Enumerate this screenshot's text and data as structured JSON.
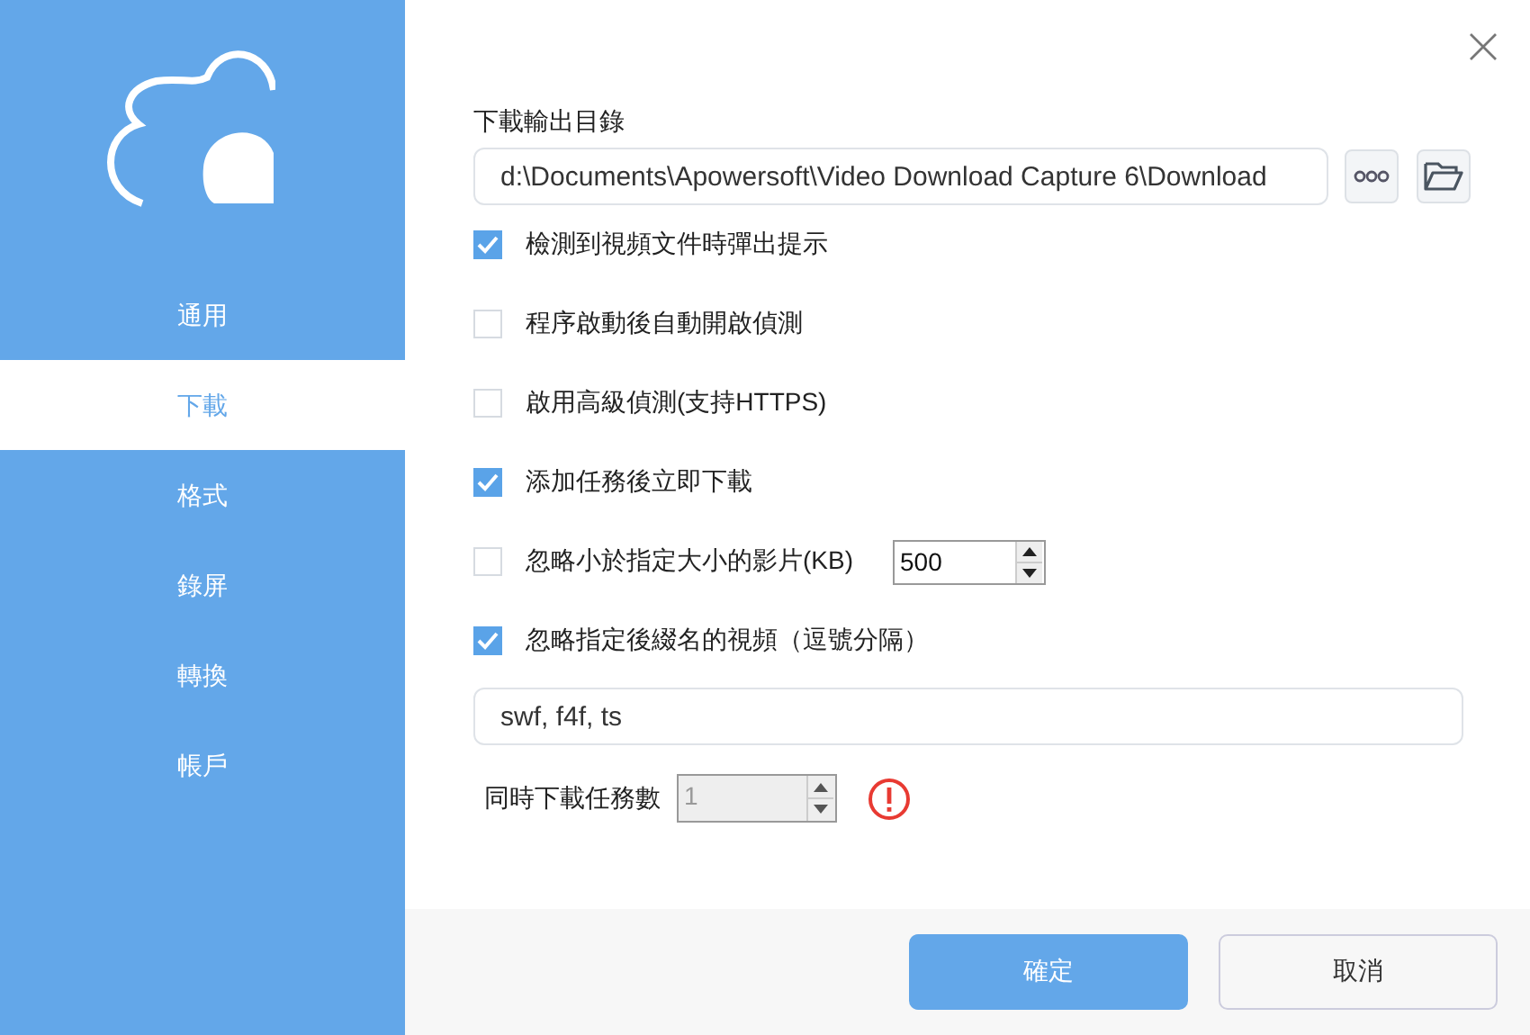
{
  "sidebar": {
    "items": [
      {
        "label": "通用",
        "selected": false
      },
      {
        "label": "下載",
        "selected": true
      },
      {
        "label": "格式",
        "selected": false
      },
      {
        "label": "錄屏",
        "selected": false
      },
      {
        "label": "轉換",
        "selected": false
      },
      {
        "label": "帳戶",
        "selected": false
      }
    ]
  },
  "output_dir": {
    "label": "下載輸出目錄",
    "value": "d:\\Documents\\Apowersoft\\Video Download Capture 6\\Download"
  },
  "options": [
    {
      "kind": "plain",
      "label": "檢測到視頻文件時彈出提示",
      "checked": true
    },
    {
      "kind": "plain",
      "label": "程序啟動後自動開啟偵測",
      "checked": false
    },
    {
      "kind": "plain",
      "label": "啟用高級偵測(支持HTTPS)",
      "checked": false
    },
    {
      "kind": "plain",
      "label": "添加任務後立即下載",
      "checked": true
    },
    {
      "kind": "number",
      "label": "忽略小於指定大小的影片(KB)",
      "checked": false,
      "value": "500"
    },
    {
      "kind": "plain",
      "label": "忽略指定後綴名的視頻（逗號分隔）",
      "checked": true
    }
  ],
  "extensions": {
    "value": "swf, f4f, ts"
  },
  "concurrent": {
    "label": "同時下載任務數",
    "value": "1",
    "disabled": true,
    "warning": true
  },
  "buttons": [
    {
      "kind": "primary",
      "label": "確定"
    },
    {
      "kind": "secondary",
      "label": "取消"
    }
  ]
}
